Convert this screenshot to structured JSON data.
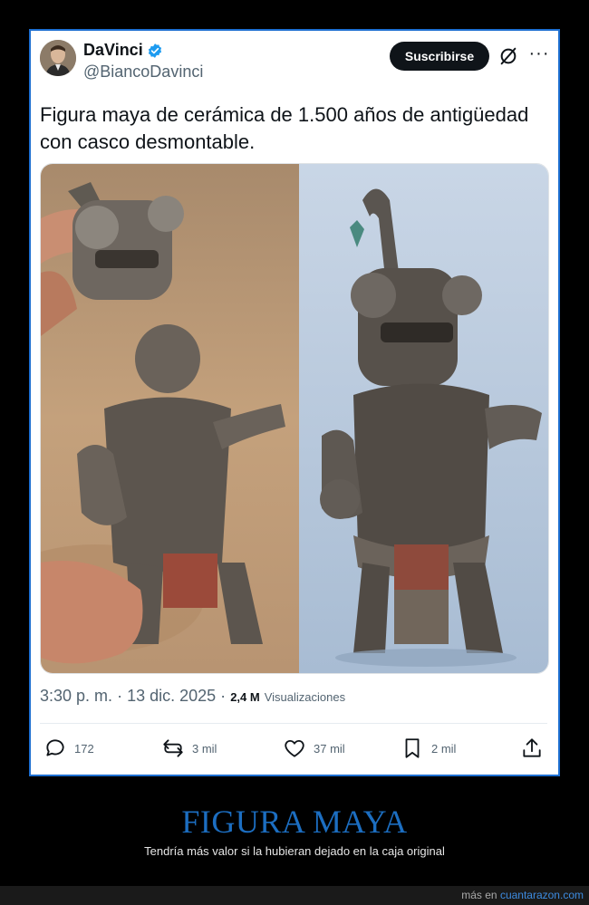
{
  "post": {
    "display_name": "DaVinci",
    "handle": "@BiancoDavinci",
    "subscribe_label": "Suscribirse",
    "more_label": "···",
    "text": "Figura maya de cerámica de 1.500 años de antigüedad con casco desmontable.",
    "time": "3:30 p. m.",
    "date": "13 dic. 2025",
    "views_count": "2,4 M",
    "views_label": "Visualizaciones",
    "separator": "·"
  },
  "actions": {
    "replies": "172",
    "reposts": "3 mil",
    "likes": "37 mil",
    "bookmarks": "2 mil"
  },
  "icons": {
    "verified": "verified-badge-icon",
    "x_logo": "x-logo-icon",
    "reply": "speech-bubble-icon",
    "repost": "repost-arrows-icon",
    "like": "heart-icon",
    "bookmark": "bookmark-icon",
    "share": "share-upload-icon"
  },
  "colors": {
    "accent_blue": "#1d9bf0",
    "frame_blue": "#1d6fd1",
    "caption_blue": "#1c6ec1",
    "text_dark": "#0f1419",
    "text_gray": "#536471"
  },
  "caption": {
    "title": "FIGURA MAYA",
    "subtitle": "Tendría más valor si la hubieran dejado en la caja original"
  },
  "footer": {
    "prefix": "más en",
    "site": "cuantarazon.com"
  }
}
